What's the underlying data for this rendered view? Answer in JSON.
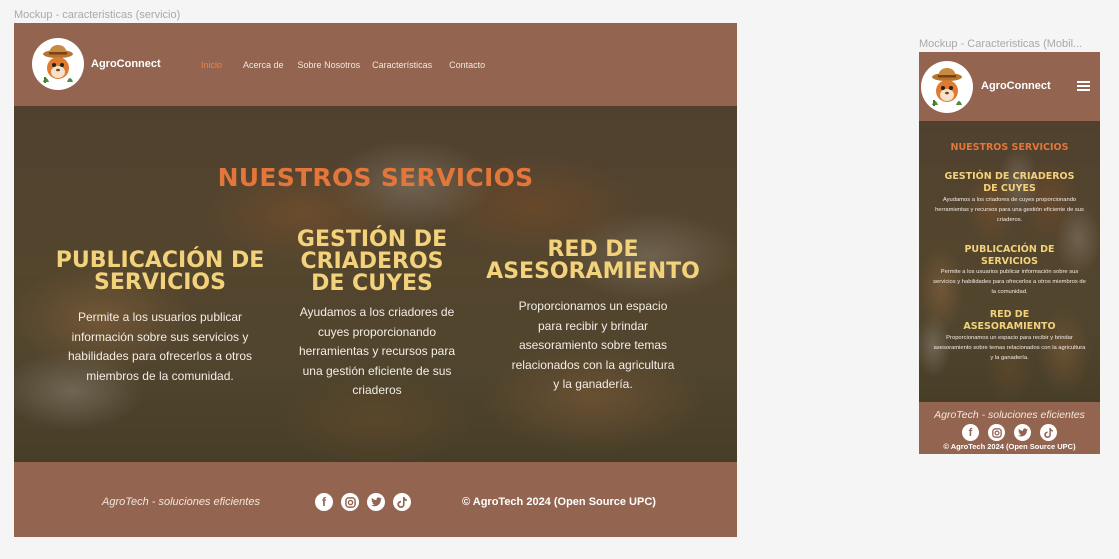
{
  "desktop": {
    "frame_label": "Mockup - caracteristicas (servicio)",
    "brand": "AgroConnect",
    "nav": [
      {
        "label": "Inicio",
        "active": true
      },
      {
        "label": "Acerca de",
        "active": false
      },
      {
        "label": "Sobre Nosotros",
        "active": false
      },
      {
        "label": "Características",
        "active": false
      },
      {
        "label": "Contacto",
        "active": false
      }
    ],
    "section_title": "NUESTROS SERVICIOS",
    "services": [
      {
        "title": "PUBLICACIÓN DE SERVICIOS",
        "text": "Permite a los usuarios publicar información sobre sus servicios y habilidades para ofrecerlos a otros miembros de la comunidad."
      },
      {
        "title": "GESTIÓN DE CRIADEROS DE CUYES",
        "text": "Ayudamos a los criadores de cuyes proporcionando herramientas y recursos para una gestión eficiente de sus criaderos"
      },
      {
        "title": "RED DE ASESORAMIENTO",
        "text": "Proporcionamos un espacio para recibir y brindar asesoramiento sobre temas relacionados con la agricultura y la ganadería."
      }
    ],
    "footer": {
      "tagline": "AgroTech - soluciones eficientes",
      "copyright": "© AgroTech 2024 (Open Source UPC)"
    }
  },
  "mobile": {
    "frame_label": "Mockup - Caracteristicas (Mobil...",
    "brand": "AgroConnect",
    "section_title": "NUESTROS SERVICIOS",
    "services": [
      {
        "title": "GESTIÓN DE CRIADEROS DE CUYES",
        "text": "Ayudamos a los criadores de cuyes proporcionando herramientas y recursos para una gestión eficiente de sus criaderos."
      },
      {
        "title": "PUBLICACIÓN DE SERVICIOS",
        "text": "Permite a los usuarios publicar información sobre sus servicios y habilidades para ofrecerlos a otros miembros de la comunidad."
      },
      {
        "title": "RED DE ASESORAMIENTO",
        "text": "Proporcionamos un espacio para recibir y brindar asesoramiento sobre temas relacionados con la agricultura y la ganadería."
      }
    ],
    "footer": {
      "tagline": "AgroTech - soluciones eficientes",
      "copyright": "© AgroTech 2024 (Open Source UPC)"
    }
  },
  "social_icons": [
    "facebook-icon",
    "instagram-icon",
    "twitter-icon",
    "tiktok-icon"
  ],
  "colors": {
    "header_footer": "#936551",
    "nav_active": "#f0823e",
    "section_title": "#e2763b",
    "service_title": "#f3d27c",
    "canvas": "#f5f5f5"
  }
}
